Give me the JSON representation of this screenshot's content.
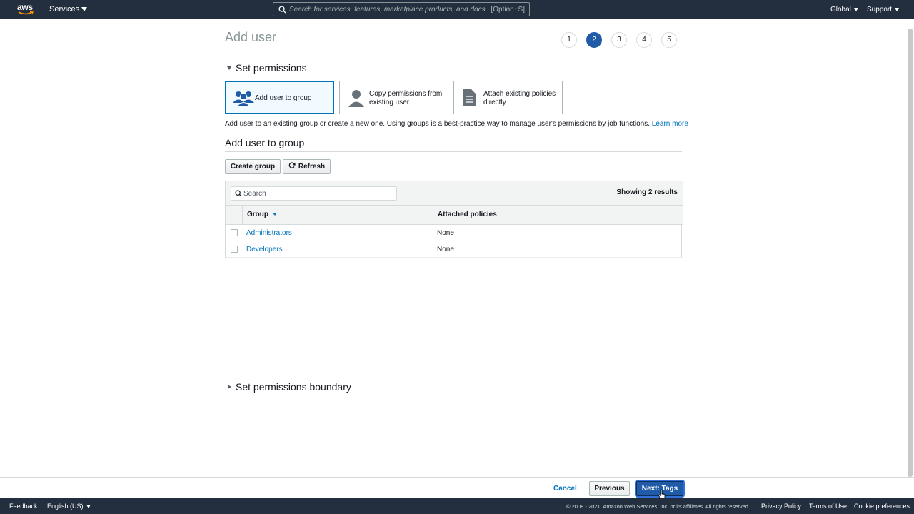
{
  "topnav": {
    "logo_text": "aws",
    "services_label": "Services",
    "search_placeholder": "Search for services, features, marketplace products, and docs",
    "search_shortcut": "[Option+S]",
    "region_label": "Global",
    "support_label": "Support"
  },
  "page": {
    "title": "Add user",
    "steps": [
      "1",
      "2",
      "3",
      "4",
      "5"
    ],
    "active_step": "2"
  },
  "permissions": {
    "section_title": "Set permissions",
    "options": [
      {
        "label": "Add user to group",
        "icon": "group-icon",
        "selected": true
      },
      {
        "label_line1": "Copy permissions from",
        "label_line2": "existing user",
        "icon": "user-icon",
        "selected": false
      },
      {
        "label_line1": "Attach existing policies",
        "label_line2": "directly",
        "icon": "document-icon",
        "selected": false
      }
    ],
    "description": "Add user to an existing group or create a new one. Using groups is a best-practice way to manage user's permissions by job functions.",
    "learn_more": "Learn more"
  },
  "group_section": {
    "title": "Add user to group",
    "create_button": "Create group",
    "refresh_button": "Refresh",
    "search_placeholder": "Search",
    "results_text": "Showing 2 results",
    "columns": [
      "Group",
      "Attached policies"
    ],
    "rows": [
      {
        "group": "Administrators",
        "policies": "None"
      },
      {
        "group": "Developers",
        "policies": "None"
      }
    ]
  },
  "boundary": {
    "section_title": "Set permissions boundary"
  },
  "actions": {
    "cancel": "Cancel",
    "previous": "Previous",
    "next": "Next: Tags"
  },
  "footer": {
    "feedback": "Feedback",
    "language": "English (US)",
    "copyright": "© 2008 - 2021, Amazon Web Services, Inc. or its affiliates. All rights reserved.",
    "privacy": "Privacy Policy",
    "terms": "Terms of Use",
    "cookies": "Cookie preferences"
  },
  "colors": {
    "nav_bg": "#232f3e",
    "accent": "#0073bb",
    "primary_button": "#1f5ba7",
    "aws_orange": "#ff9900"
  }
}
